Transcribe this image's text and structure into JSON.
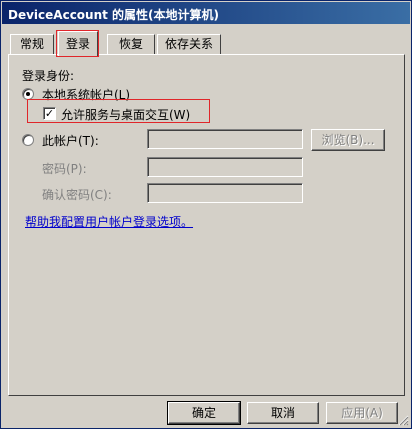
{
  "window": {
    "title": "DeviceAccount 的属性(本地计算机)"
  },
  "tabs": [
    {
      "label": "常规"
    },
    {
      "label": "登录"
    },
    {
      "label": "恢复"
    },
    {
      "label": "依存关系"
    }
  ],
  "logon": {
    "section_label": "登录身份:",
    "local_system_label": "本地系统帐户(L)",
    "interact_desktop_label": "允许服务与桌面交互(W)",
    "interact_desktop_checked": true,
    "this_account_label": "此帐户(T):",
    "this_account_value": "",
    "password_label": "密码(P):",
    "password_value": "",
    "confirm_password_label": "确认密码(C):",
    "confirm_password_value": "",
    "browse_label": "浏览(B)...",
    "help_link": "帮助我配置用户帐户登录选项。"
  },
  "footer": {
    "ok_label": "确定",
    "cancel_label": "取消",
    "apply_label": "应用(A)"
  }
}
